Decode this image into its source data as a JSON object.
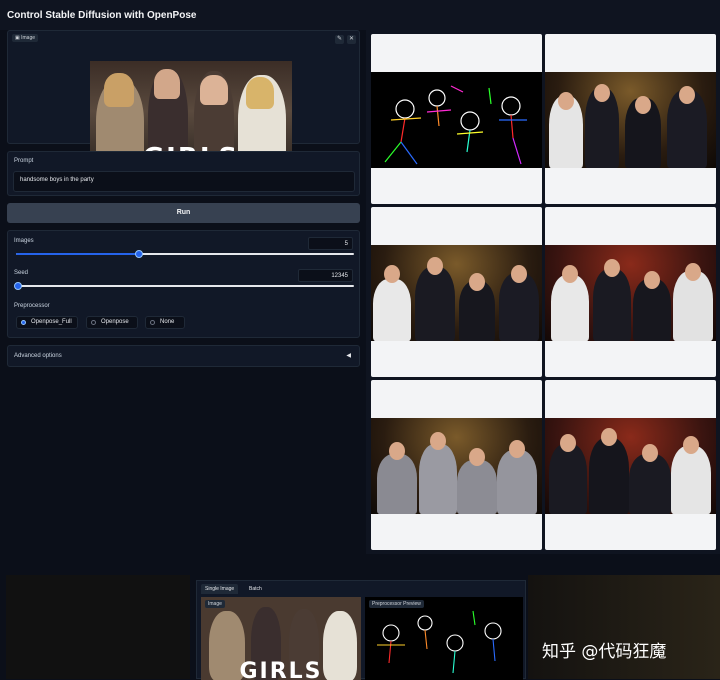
{
  "app": {
    "title": "Control Stable Diffusion with OpenPose"
  },
  "image_input": {
    "label": "Image",
    "overlay_text": "GIRLS",
    "edit_icon": "pencil-icon",
    "close_icon": "close-icon"
  },
  "prompt": {
    "label": "Prompt",
    "value": "handsome boys in the party"
  },
  "run": {
    "label": "Run"
  },
  "images_slider": {
    "label": "Images",
    "value": "5",
    "level": 0.36
  },
  "seed_slider": {
    "label": "Seed",
    "value": "12345",
    "level": 0.0
  },
  "preprocessor": {
    "label": "Preprocessor",
    "options": [
      "Openpose_Full",
      "Openpose",
      "None"
    ],
    "selected": "Openpose_Full"
  },
  "advanced": {
    "label": "Advanced options",
    "arrow": "◀"
  },
  "gallery": {
    "items": [
      "pose-skeleton",
      "boys-1",
      "boys-2",
      "boys-3",
      "boys-4",
      "boys-5"
    ]
  },
  "bottom": {
    "tabs": [
      "Single Image",
      "Batch"
    ],
    "image_label": "Image",
    "pose_label": "Preprocessor Preview",
    "overlay_text": "GIRLS",
    "watermark": "知乎 @代码狂魔"
  },
  "colors": {
    "accent": "#2563eb",
    "background": "#0b0f19",
    "panel": "#111827"
  }
}
